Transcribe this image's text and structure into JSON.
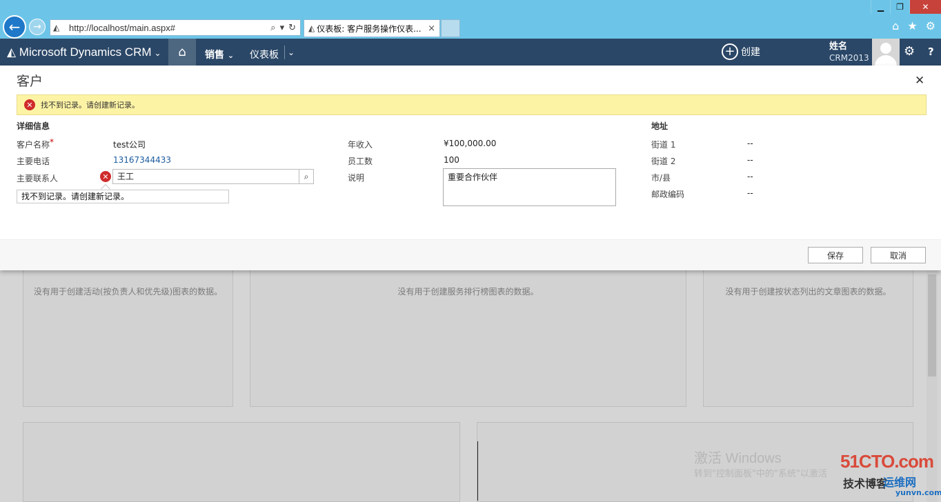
{
  "browser": {
    "url": "http://localhost/main.aspx#",
    "tab_title": "仪表板: 客户服务操作仪表...",
    "tab_close": "×"
  },
  "crm": {
    "brand": "Microsoft Dynamics CRM",
    "nav_sales": "销售",
    "nav_dashboard": "仪表板",
    "create_label": "创建",
    "user_name": "姓名",
    "user_org": "CRM2013",
    "help": "?"
  },
  "dialog": {
    "title": "客户",
    "banner_message": "找不到记录。请创建新记录。",
    "section_details": "详细信息",
    "section_address": "地址",
    "fields": {
      "account_name_label": "客户名称",
      "account_name_value": "test公司",
      "main_phone_label": "主要电话",
      "main_phone_value": "13167344433",
      "primary_contact_label": "主要联系人",
      "primary_contact_value": "王工",
      "primary_contact_error": "找不到记录。请创建新记录。",
      "annual_revenue_label": "年收入",
      "annual_revenue_value": "¥100,000.00",
      "employees_label": "员工数",
      "employees_value": "100",
      "description_label": "说明",
      "description_value": "重要合作伙伴",
      "street1_label": "街道 1",
      "street1_value": "--",
      "street2_label": "街道 2",
      "street2_value": "--",
      "city_label": "市/县",
      "city_value": "--",
      "zip_label": "邮政编码",
      "zip_value": "--"
    },
    "save_label": "保存",
    "cancel_label": "取消"
  },
  "dashboard": {
    "panel1_msg": "没有用于创建活动(按负责人和优先级)图表的数据。",
    "panel2_msg": "没有用于创建服务排行榜图表的数据。",
    "panel3_msg": "没有用于创建按状态列出的文章图表的数据。"
  },
  "watermark": {
    "activate_title": "激活 Windows",
    "activate_sub": "转到\"控制面板\"中的\"系统\"以激活",
    "logo_main": "51CTO.com",
    "logo_sub1": "技术博客",
    "logo_sub2": "运维网",
    "logo_url": "yunvn.com"
  },
  "icons": {
    "back": "back-arrow-icon",
    "forward": "forward-arrow-icon",
    "search": "search-icon",
    "refresh": "refresh-icon",
    "home": "home-icon",
    "favorites": "star-icon",
    "settings": "gear-icon",
    "close": "close-icon",
    "error": "error-icon"
  },
  "colors": {
    "chrome": "#6cc5e8",
    "crm_nav": "#2b4767",
    "banner": "#fdf3a5",
    "error": "#d02b2b",
    "link": "#1a5a9e"
  }
}
